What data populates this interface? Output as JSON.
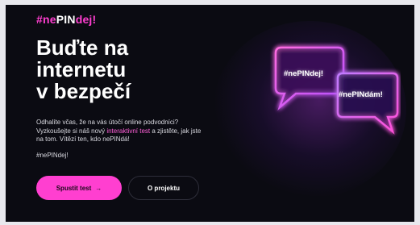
{
  "logo": {
    "part1": "#ne",
    "part2": "PIN",
    "part3": "dej!"
  },
  "headline": {
    "line1": "Buďte na",
    "line2": "internetu",
    "line3": "v bezpečí"
  },
  "description": {
    "text1": "Odhalíte včas, že na vás útočí online podvodníci? Vyzkoušejte si náš nový ",
    "highlight": "interaktivní test",
    "text2": " a zjistěte, jak jste na tom. Vítězí ten, kdo nePINdá!"
  },
  "hashtag": "#nePINdej!",
  "buttons": {
    "primary_label": "Spustit test",
    "primary_arrow": "→",
    "secondary_label": "O projektu"
  },
  "illustration": {
    "bubble1_text": "#nePINdej!",
    "bubble2_text": "#nePINdám!"
  },
  "colors": {
    "accent": "#ff3fd0",
    "background": "#0b0b12",
    "glow": "#b04dff"
  }
}
